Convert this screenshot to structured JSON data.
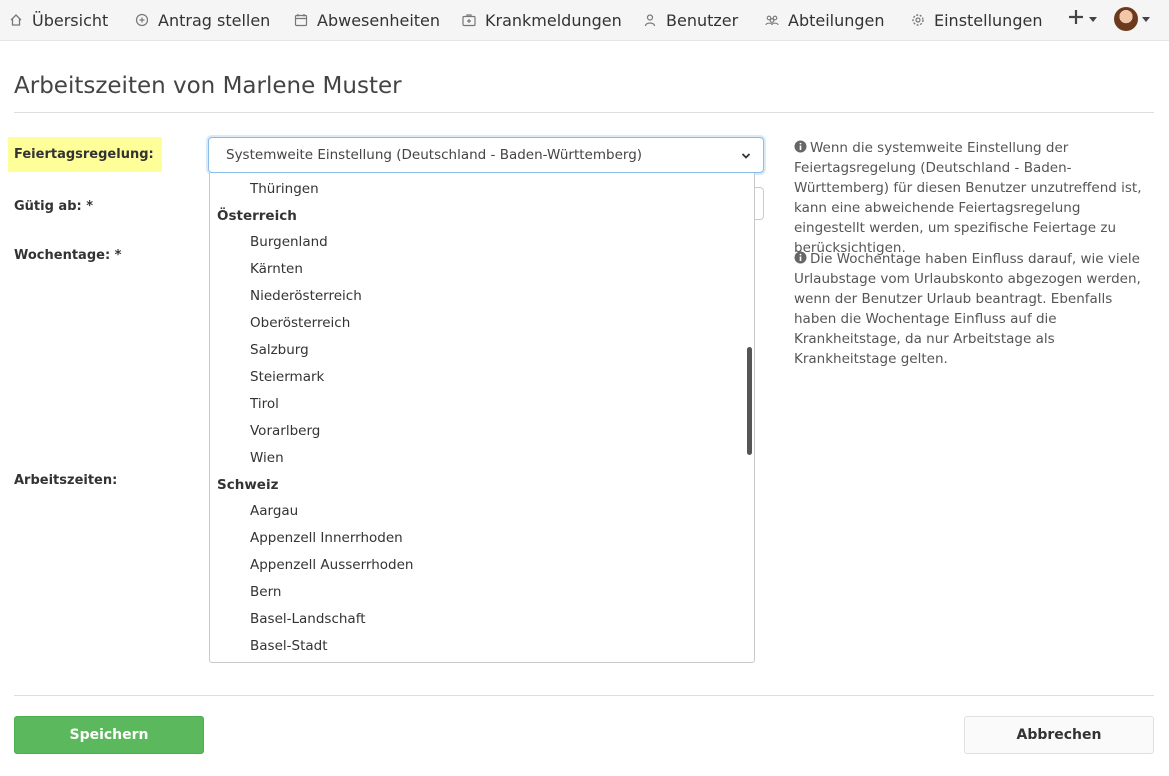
{
  "nav": {
    "overview": "Übersicht",
    "new_request": "Antrag stellen",
    "absences": "Abwesenheiten",
    "sick_notes": "Krankmeldungen",
    "users": "Benutzer",
    "departments": "Abteilungen",
    "settings": "Einstellungen"
  },
  "page": {
    "title": "Arbeitszeiten von Marlene Muster"
  },
  "form": {
    "holiday_label": "Feiertagsregelung:",
    "valid_from_label": "Gütig ab: *",
    "weekdays_label": "Wochentage: *",
    "working_times_label": "Arbeitszeiten:",
    "holiday_select_value": "Systemweite Einstellung (Deutschland - Baden-Württemberg)"
  },
  "dropdown": {
    "items": [
      {
        "type": "option",
        "label": "Thüringen"
      },
      {
        "type": "group",
        "label": "Österreich"
      },
      {
        "type": "option",
        "label": "Burgenland"
      },
      {
        "type": "option",
        "label": "Kärnten"
      },
      {
        "type": "option",
        "label": "Niederösterreich"
      },
      {
        "type": "option",
        "label": "Oberösterreich"
      },
      {
        "type": "option",
        "label": "Salzburg"
      },
      {
        "type": "option",
        "label": "Steiermark"
      },
      {
        "type": "option",
        "label": "Tirol"
      },
      {
        "type": "option",
        "label": "Vorarlberg"
      },
      {
        "type": "option",
        "label": "Wien"
      },
      {
        "type": "group",
        "label": "Schweiz"
      },
      {
        "type": "option",
        "label": "Aargau"
      },
      {
        "type": "option",
        "label": "Appenzell Innerrhoden"
      },
      {
        "type": "option",
        "label": "Appenzell Ausserrhoden"
      },
      {
        "type": "option",
        "label": "Bern"
      },
      {
        "type": "option",
        "label": "Basel-Landschaft"
      },
      {
        "type": "option",
        "label": "Basel-Stadt"
      }
    ]
  },
  "help": {
    "holiday_text": "Wenn die systemweite Einstellung der Feiertagsregelung (Deutschland - Baden-Württemberg) für diesen Benutzer unzutreffend ist, kann eine abweichende Feiertagsregelung eingestellt werden, um spezifische Feiertage zu berücksichtigen.",
    "weekdays_text": "Die Wochentage haben Einfluss darauf, wie viele Urlaubstage vom Urlaubskonto abgezogen werden, wenn der Benutzer Urlaub beantragt. Ebenfalls haben die Wochentage Einfluss auf die Krankheitstage, da nur Arbeitstage als Krankheitstage gelten."
  },
  "actions": {
    "save": "Speichern",
    "cancel": "Abbrechen"
  },
  "colors": {
    "save_button": "#5cb85c",
    "highlight": "#ffff99",
    "focus_border": "#8bbbe8"
  }
}
